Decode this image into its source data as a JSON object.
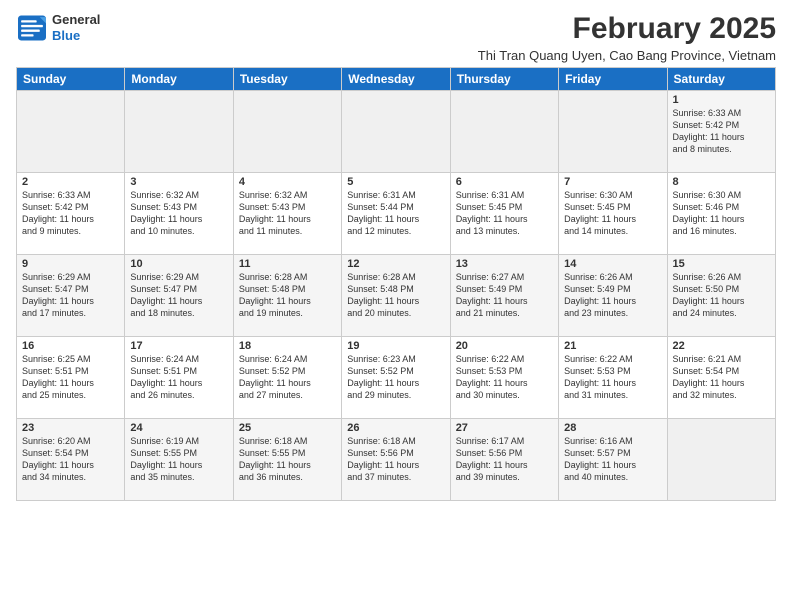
{
  "logo": {
    "line1": "General",
    "line2": "Blue"
  },
  "title": "February 2025",
  "subtitle": "Thi Tran Quang Uyen, Cao Bang Province, Vietnam",
  "days_of_week": [
    "Sunday",
    "Monday",
    "Tuesday",
    "Wednesday",
    "Thursday",
    "Friday",
    "Saturday"
  ],
  "weeks": [
    {
      "days": [
        {
          "num": "",
          "info": ""
        },
        {
          "num": "",
          "info": ""
        },
        {
          "num": "",
          "info": ""
        },
        {
          "num": "",
          "info": ""
        },
        {
          "num": "",
          "info": ""
        },
        {
          "num": "",
          "info": ""
        },
        {
          "num": "1",
          "info": "Sunrise: 6:33 AM\nSunset: 5:42 PM\nDaylight: 11 hours\nand 8 minutes."
        }
      ]
    },
    {
      "days": [
        {
          "num": "2",
          "info": "Sunrise: 6:33 AM\nSunset: 5:42 PM\nDaylight: 11 hours\nand 9 minutes."
        },
        {
          "num": "3",
          "info": "Sunrise: 6:32 AM\nSunset: 5:43 PM\nDaylight: 11 hours\nand 10 minutes."
        },
        {
          "num": "4",
          "info": "Sunrise: 6:32 AM\nSunset: 5:43 PM\nDaylight: 11 hours\nand 11 minutes."
        },
        {
          "num": "5",
          "info": "Sunrise: 6:31 AM\nSunset: 5:44 PM\nDaylight: 11 hours\nand 12 minutes."
        },
        {
          "num": "6",
          "info": "Sunrise: 6:31 AM\nSunset: 5:45 PM\nDaylight: 11 hours\nand 13 minutes."
        },
        {
          "num": "7",
          "info": "Sunrise: 6:30 AM\nSunset: 5:45 PM\nDaylight: 11 hours\nand 14 minutes."
        },
        {
          "num": "8",
          "info": "Sunrise: 6:30 AM\nSunset: 5:46 PM\nDaylight: 11 hours\nand 16 minutes."
        }
      ]
    },
    {
      "days": [
        {
          "num": "9",
          "info": "Sunrise: 6:29 AM\nSunset: 5:47 PM\nDaylight: 11 hours\nand 17 minutes."
        },
        {
          "num": "10",
          "info": "Sunrise: 6:29 AM\nSunset: 5:47 PM\nDaylight: 11 hours\nand 18 minutes."
        },
        {
          "num": "11",
          "info": "Sunrise: 6:28 AM\nSunset: 5:48 PM\nDaylight: 11 hours\nand 19 minutes."
        },
        {
          "num": "12",
          "info": "Sunrise: 6:28 AM\nSunset: 5:48 PM\nDaylight: 11 hours\nand 20 minutes."
        },
        {
          "num": "13",
          "info": "Sunrise: 6:27 AM\nSunset: 5:49 PM\nDaylight: 11 hours\nand 21 minutes."
        },
        {
          "num": "14",
          "info": "Sunrise: 6:26 AM\nSunset: 5:49 PM\nDaylight: 11 hours\nand 23 minutes."
        },
        {
          "num": "15",
          "info": "Sunrise: 6:26 AM\nSunset: 5:50 PM\nDaylight: 11 hours\nand 24 minutes."
        }
      ]
    },
    {
      "days": [
        {
          "num": "16",
          "info": "Sunrise: 6:25 AM\nSunset: 5:51 PM\nDaylight: 11 hours\nand 25 minutes."
        },
        {
          "num": "17",
          "info": "Sunrise: 6:24 AM\nSunset: 5:51 PM\nDaylight: 11 hours\nand 26 minutes."
        },
        {
          "num": "18",
          "info": "Sunrise: 6:24 AM\nSunset: 5:52 PM\nDaylight: 11 hours\nand 27 minutes."
        },
        {
          "num": "19",
          "info": "Sunrise: 6:23 AM\nSunset: 5:52 PM\nDaylight: 11 hours\nand 29 minutes."
        },
        {
          "num": "20",
          "info": "Sunrise: 6:22 AM\nSunset: 5:53 PM\nDaylight: 11 hours\nand 30 minutes."
        },
        {
          "num": "21",
          "info": "Sunrise: 6:22 AM\nSunset: 5:53 PM\nDaylight: 11 hours\nand 31 minutes."
        },
        {
          "num": "22",
          "info": "Sunrise: 6:21 AM\nSunset: 5:54 PM\nDaylight: 11 hours\nand 32 minutes."
        }
      ]
    },
    {
      "days": [
        {
          "num": "23",
          "info": "Sunrise: 6:20 AM\nSunset: 5:54 PM\nDaylight: 11 hours\nand 34 minutes."
        },
        {
          "num": "24",
          "info": "Sunrise: 6:19 AM\nSunset: 5:55 PM\nDaylight: 11 hours\nand 35 minutes."
        },
        {
          "num": "25",
          "info": "Sunrise: 6:18 AM\nSunset: 5:55 PM\nDaylight: 11 hours\nand 36 minutes."
        },
        {
          "num": "26",
          "info": "Sunrise: 6:18 AM\nSunset: 5:56 PM\nDaylight: 11 hours\nand 37 minutes."
        },
        {
          "num": "27",
          "info": "Sunrise: 6:17 AM\nSunset: 5:56 PM\nDaylight: 11 hours\nand 39 minutes."
        },
        {
          "num": "28",
          "info": "Sunrise: 6:16 AM\nSunset: 5:57 PM\nDaylight: 11 hours\nand 40 minutes."
        },
        {
          "num": "",
          "info": ""
        }
      ]
    }
  ]
}
